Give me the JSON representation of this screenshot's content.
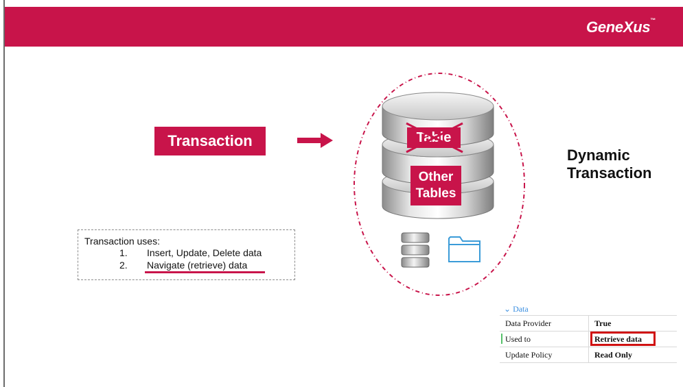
{
  "header": {
    "brand": "GeneXus",
    "brand_mark": "™",
    "color": "#c8144a"
  },
  "transaction_label": "Transaction",
  "db": {
    "table_label": "Table",
    "other_tables": [
      "Other",
      "Tables"
    ]
  },
  "dynamic": [
    "Dynamic",
    "Transaction"
  ],
  "uses": {
    "title": "Transaction uses:",
    "items": [
      {
        "num": "1.",
        "text": "Insert, Update, Delete data"
      },
      {
        "num": "2.",
        "text": "Navigate (retrieve) data"
      }
    ]
  },
  "properties": {
    "group": "Data",
    "rows": [
      {
        "key": "Data Provider",
        "value": "True"
      },
      {
        "key": "Used to",
        "value": "Retrieve data"
      },
      {
        "key": "Update Policy",
        "value": "Read Only"
      }
    ]
  }
}
